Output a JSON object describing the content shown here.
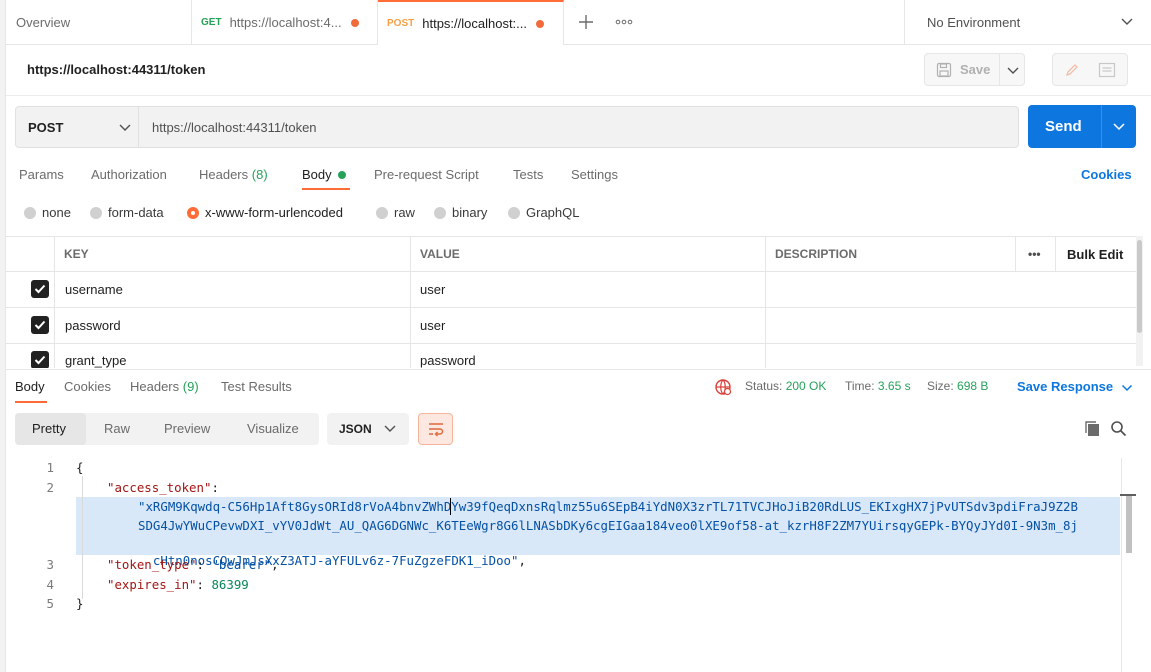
{
  "tabs": {
    "overview": "Overview",
    "tab1": {
      "method": "GET",
      "label": "https://localhost:4..."
    },
    "tab2": {
      "method": "POST",
      "label": "https://localhost:..."
    },
    "environment": "No Environment"
  },
  "request": {
    "title": "https://localhost:44311/token",
    "save_label": "Save",
    "method": "POST",
    "url": "https://localhost:44311/token",
    "send_label": "Send"
  },
  "request_tabs": {
    "params": "Params",
    "authorization": "Authorization",
    "headers": "Headers",
    "headers_count": "(8)",
    "body": "Body",
    "prerequest": "Pre-request Script",
    "tests": "Tests",
    "settings": "Settings",
    "cookies": "Cookies"
  },
  "body_types": [
    "none",
    "form-data",
    "x-www-form-urlencoded",
    "raw",
    "binary",
    "GraphQL"
  ],
  "body_type_selected": "x-www-form-urlencoded",
  "params_table": {
    "headers": {
      "key": "KEY",
      "value": "VALUE",
      "description": "DESCRIPTION",
      "more": "•••",
      "bulk_edit": "Bulk Edit"
    },
    "rows": [
      {
        "key": "username",
        "value": "user",
        "checked": true
      },
      {
        "key": "password",
        "value": "user",
        "checked": true
      },
      {
        "key": "grant_type",
        "value": "password",
        "checked": true
      }
    ]
  },
  "response_tabs": {
    "body": "Body",
    "cookies": "Cookies",
    "headers": "Headers",
    "headers_count": "(9)",
    "test_results": "Test Results"
  },
  "response_status": {
    "status_label": "Status:",
    "status_value": "200 OK",
    "time_label": "Time:",
    "time_value": "3.65 s",
    "size_label": "Size:",
    "size_value": "698 B",
    "save_response": "Save Response"
  },
  "format": {
    "pretty": "Pretty",
    "raw": "Raw",
    "preview": "Preview",
    "visualize": "Visualize",
    "language": "JSON"
  },
  "code": {
    "line_numbers": [
      "1",
      "2",
      "3",
      "4",
      "5"
    ],
    "open_brace": "{",
    "close_brace": "}",
    "access_token_key": "\"access_token\"",
    "token_line1": "\"xRGM9Kqwdq-C56Hp1Aft8GysORId8rVoA4bnvZWhDYw39fQeqDxnsRqlmz55u6SEpB4iYdN0X3zrTL71TVCJHoJiB20RdLUS_EKIxgHX7jPvUTSdv3pdiFraJ9Z2B",
    "token_line2": "SDG4JwYWuCPevwDXI_vYV0JdWt_AU_QAG6DGNWc_K6TEeWgr8G6lLNASbDKy6cgEIGaa184veo0lXE9of58-at_kzrH8F2ZM7YUirsqyGEPk-BYQyJYd0I-9N3m_8j",
    "token_line3": "cHtn0nosCQwJmJsXxZ3ATJ-aYFULv6z-7FuZgzeFDK1_iDoo\"",
    "token_type_key": "\"token_type\"",
    "token_type_value": "\"bearer\"",
    "expires_in_key": "\"expires_in\"",
    "expires_in_value": "86399"
  },
  "colors": {
    "accent": "#ff6c37",
    "primary": "#0e77df",
    "success": "#26a159"
  }
}
